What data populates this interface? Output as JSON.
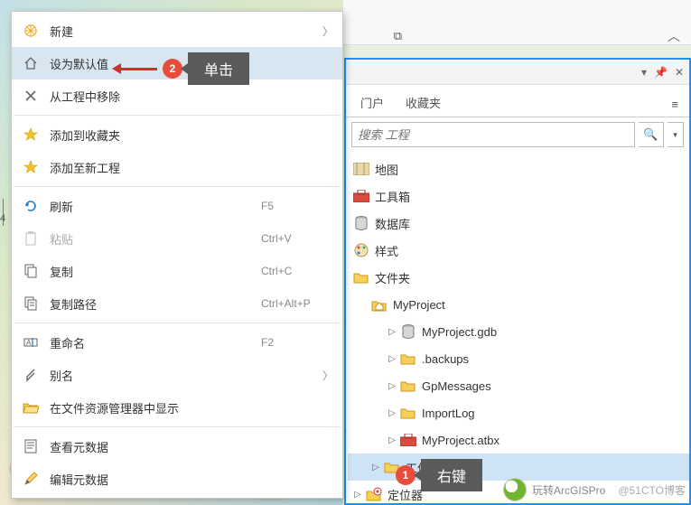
{
  "menu": {
    "new": "新建",
    "set_default": "设为默认值",
    "remove_from_project": "从工程中移除",
    "add_to_fav": "添加到收藏夹",
    "add_to_new_project": "添加至新工程",
    "refresh": "刷新",
    "refresh_sc": "F5",
    "paste": "粘贴",
    "paste_sc": "Ctrl+V",
    "copy": "复制",
    "copy_sc": "Ctrl+C",
    "copy_path": "复制路径",
    "copy_path_sc": "Ctrl+Alt+P",
    "rename": "重命名",
    "rename_sc": "F2",
    "alias": "别名",
    "show_in_explorer": "在文件资源管理器中显示",
    "view_metadata": "查看元数据",
    "edit_metadata": "编辑元数据"
  },
  "annotations": {
    "badge2": "2",
    "tip2": "单击",
    "badge1": "1",
    "tip1": "右键"
  },
  "catalog": {
    "tab_portal": "门户",
    "tab_fav": "收藏夹",
    "search_placeholder": "搜索 工程",
    "nodes": {
      "maps": "地图",
      "toolbox": "工具箱",
      "database": "数据库",
      "style": "样式",
      "folders": "文件夹",
      "myproject": "MyProject",
      "gdb": "MyProject.gdb",
      "backups": ".backups",
      "gpmessages": "GpMessages",
      "importlog": "ImportLog",
      "atbx": "MyProject.atbx",
      "work": "工作",
      "locator": "定位器"
    }
  },
  "watermark": {
    "brand": "玩转ArcGISPro",
    "credit": "@51CTO博客"
  },
  "misc": {
    "four": "4"
  }
}
